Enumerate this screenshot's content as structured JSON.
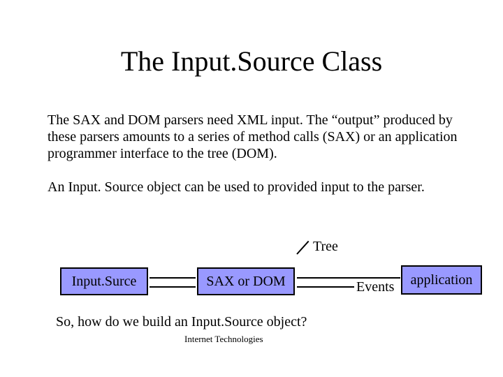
{
  "title": "The Input.Source Class",
  "para1": "The SAX and DOM parsers need XML input. The “output” produced by these parsers amounts to a series of method calls (SAX) or an application programmer interface to the tree (DOM).",
  "para2": "An Input. Source object can be used to provided input to the parser.",
  "labels": {
    "tree": "Tree",
    "events": "Events"
  },
  "boxes": {
    "input": "Input.Surce",
    "parser": "SAX or DOM",
    "app": "application"
  },
  "question": "So, how do we build an Input.Source object?",
  "footer": "Internet Technologies"
}
